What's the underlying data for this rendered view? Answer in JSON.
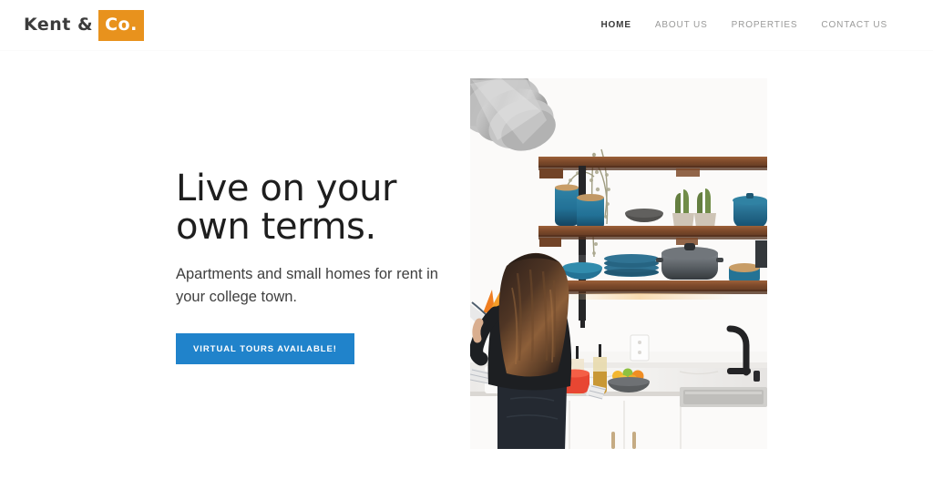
{
  "header": {
    "logo": {
      "text": "Kent &",
      "badge": "Co.",
      "badge_color": "#e8921d"
    },
    "nav": [
      {
        "label": "HOME",
        "active": true
      },
      {
        "label": "ABOUT US",
        "active": false
      },
      {
        "label": "PROPERTIES",
        "active": false
      },
      {
        "label": "CONTACT US",
        "active": false
      }
    ]
  },
  "hero": {
    "title": "Live on your own terms.",
    "subtitle": "Apartments and small homes for rent in your college town.",
    "cta_label": "Virtual tours available!",
    "cta_color": "#2083cb",
    "image_alt": "Woman in black top standing at a white marble kitchen counter with wooden open shelving holding blue ceramic mugs, plates, bowls, a gray Dutch oven, small potted cacti, dried flowers, stacked metal pots hanging at the top left, oil bottles, a red bowl, a bowl of lemons limes and oranges, a stainless steel sink and a black faucet."
  },
  "colors": {
    "background": "#ffffff",
    "text_primary": "#1e1e1e",
    "text_muted": "#9a9a99",
    "accent_orange": "#e8921d",
    "accent_blue": "#2083cb"
  }
}
